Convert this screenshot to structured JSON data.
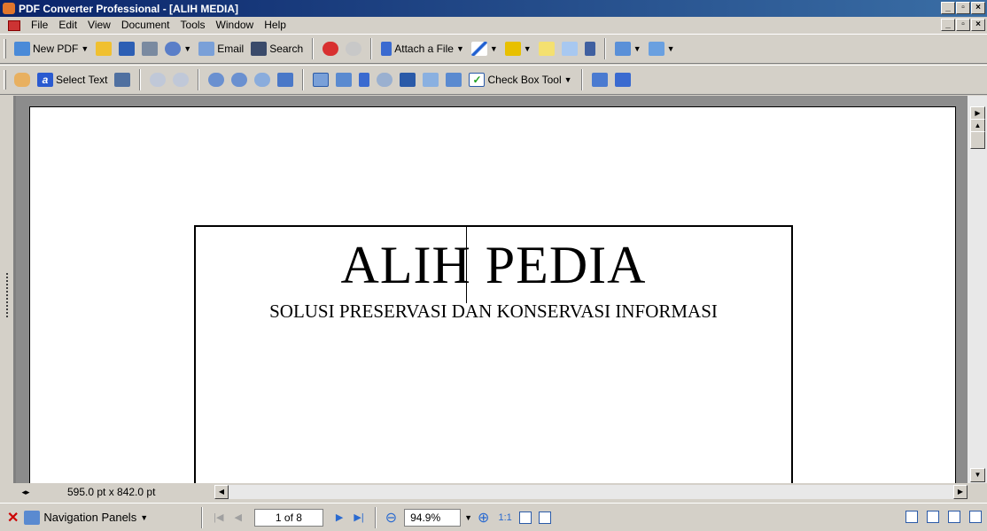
{
  "window": {
    "title": "PDF Converter Professional - [ALIH MEDIA]"
  },
  "menu": [
    "File",
    "Edit",
    "View",
    "Document",
    "Tools",
    "Window",
    "Help"
  ],
  "toolbar1": {
    "new_pdf": "New PDF",
    "email": "Email",
    "search": "Search",
    "attach_file": "Attach a File"
  },
  "toolbar2": {
    "select_text": "Select Text",
    "check_box_tool": "Check Box Tool"
  },
  "document": {
    "title": "ALIH PEDIA",
    "subtitle": "SOLUSI PRESERVASI DAN KONSERVASI INFORMASI"
  },
  "page_size": "595.0 pt x 842.0 pt",
  "statusbar": {
    "navigation_panels": "Navigation Panels",
    "page_indicator": "1 of 8",
    "zoom": "94.9%"
  },
  "colors": {
    "titlebar_start": "#0a246a",
    "titlebar_end": "#3a6ea5",
    "chrome": "#d4d0c8"
  }
}
